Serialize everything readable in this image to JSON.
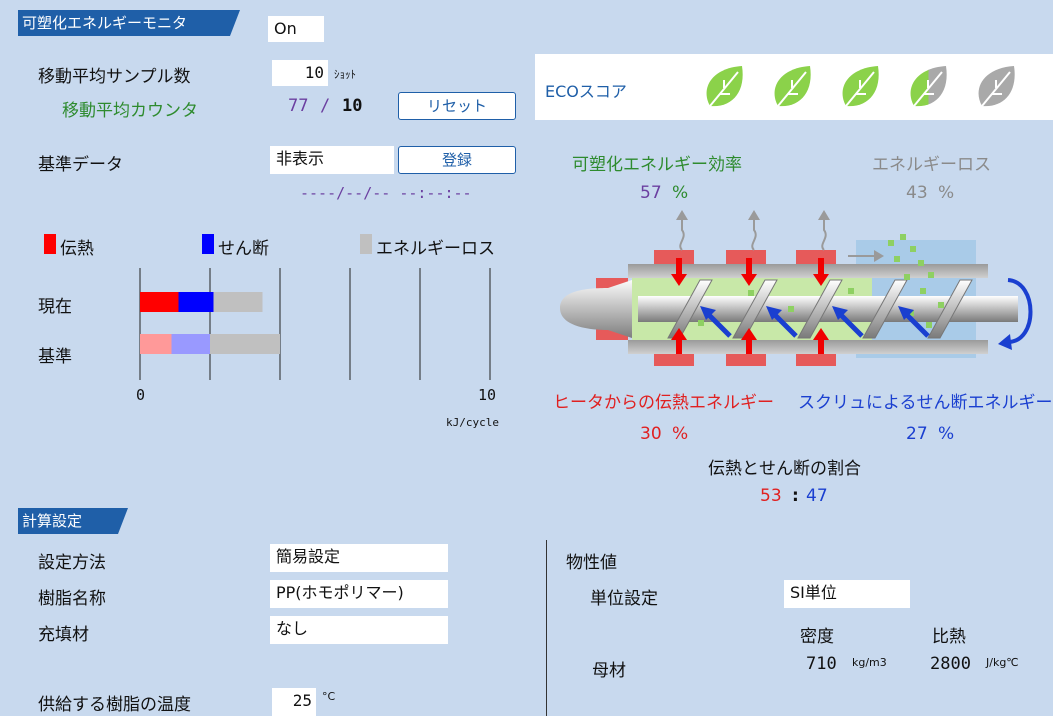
{
  "header": {
    "title": "可塑化エネルギーモニタ",
    "toggle_value": "On"
  },
  "moving_avg": {
    "sample_label": "移動平均サンプル数",
    "sample_value": "10",
    "sample_unit": "ｼｮｯﾄ",
    "counter_label": "移動平均カウンタ",
    "counter_current": "77",
    "counter_sep": "/",
    "counter_total": "10",
    "reset_label": "リセット"
  },
  "reference": {
    "label": "基準データ",
    "display_value": "非表示",
    "register_label": "登録",
    "timestamp": "----/--/-- --:--:--"
  },
  "eco": {
    "label": "ECOスコア",
    "leaves": [
      1,
      1,
      1,
      0.5,
      0
    ]
  },
  "legend": {
    "heat": "伝熱",
    "shear": "せん断",
    "loss": "エネルギーロス"
  },
  "bar_chart": {
    "rows": [
      "現在",
      "基準"
    ],
    "tick_min": "0",
    "tick_max": "10",
    "unit": "kJ/cycle"
  },
  "chart_data": {
    "type": "bar",
    "orientation": "horizontal",
    "stacked": true,
    "categories": [
      "現在",
      "基準"
    ],
    "series": [
      {
        "name": "伝熱",
        "values": [
          1.1,
          0.9
        ]
      },
      {
        "name": "せん断",
        "values": [
          1.0,
          1.1
        ]
      },
      {
        "name": "エネルギーロス",
        "values": [
          1.4,
          2.0
        ]
      }
    ],
    "xlim": [
      0,
      10
    ],
    "xlabel": "kJ/cycle",
    "colors": {
      "current": [
        "#ff0000",
        "#0000ff",
        "#c0c0c0"
      ],
      "reference": [
        "#ff9999",
        "#9999ff",
        "#c0c0c0"
      ]
    }
  },
  "efficiency": {
    "label": "可塑化エネルギー効率",
    "value": "57",
    "unit": "%",
    "loss_label": "エネルギーロス",
    "loss_value": "43",
    "loss_unit": "%"
  },
  "heater": {
    "label": "ヒータからの伝熱エネルギー",
    "value": "30",
    "unit": "%"
  },
  "screw": {
    "label": "スクリュによるせん断エネルギー",
    "value": "27",
    "unit": "%"
  },
  "ratio": {
    "label": "伝熱とせん断の割合",
    "heat": "53",
    "sep": ":",
    "shear": "47"
  },
  "calc": {
    "title": "計算設定",
    "method_label": "設定方法",
    "method_value": "簡易設定",
    "resin_label": "樹脂名称",
    "resin_value": "PP(ホモポリマー)",
    "filler_label": "充填材",
    "filler_value": "なし",
    "temp_label": "供給する樹脂の温度",
    "temp_value": "25",
    "temp_unit": "°C"
  },
  "props": {
    "title": "物性値",
    "unit_label": "単位設定",
    "unit_value": "SI単位",
    "density_header": "密度",
    "specific_heat_header": "比熱",
    "base_label": "母材",
    "density_value": "710",
    "density_unit": "kg/m3",
    "specific_heat_value": "2800",
    "specific_heat_unit": "J/kg℃"
  },
  "colors": {
    "accent": "#1f5fa8",
    "green": "#2e8b2e",
    "purple": "#6b3fa0",
    "red": "#e02020",
    "blue": "#1a3fd0",
    "gray": "#8a8a8a"
  }
}
